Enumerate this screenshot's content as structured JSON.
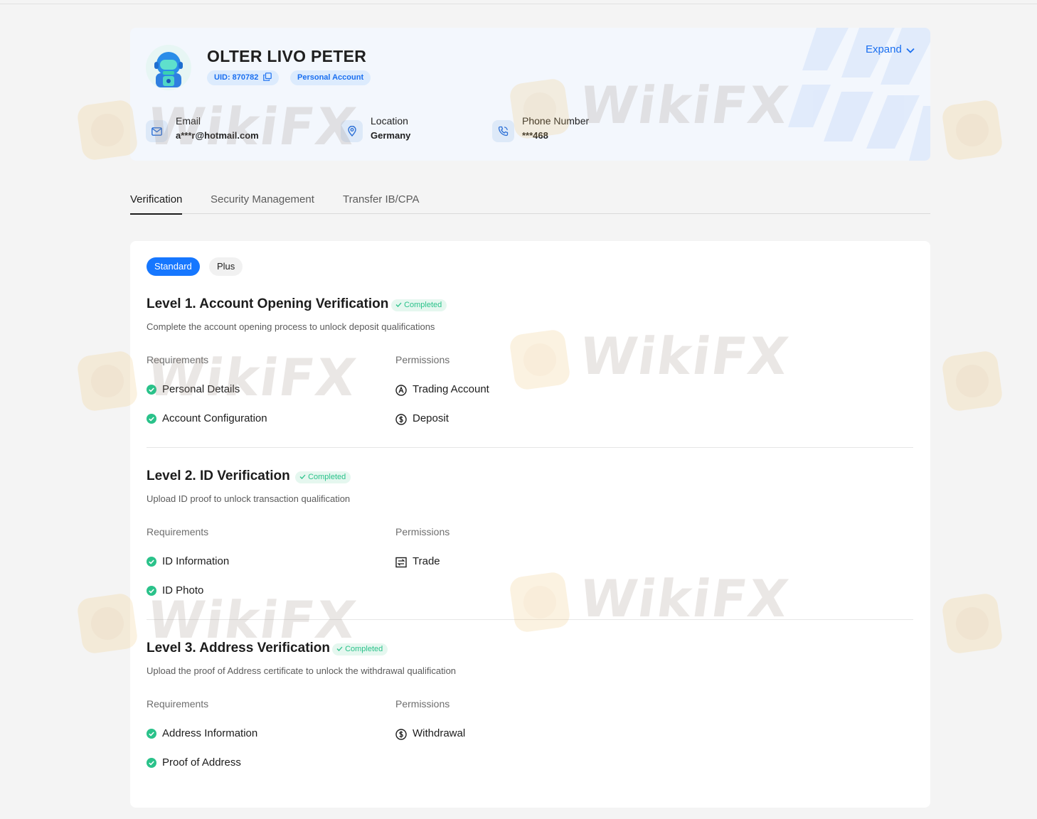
{
  "profile": {
    "name": "OLTER LIVO PETER",
    "uid": "UID: 870782",
    "account_type": "Personal Account",
    "expand": "Expand",
    "email_label": "Email",
    "email_value": "a***r@hotmail.com",
    "location_label": "Location",
    "location_value": "Germany",
    "phone_label": "Phone Number",
    "phone_value": "***468"
  },
  "tabs": [
    "Verification",
    "Security Management",
    "Transfer IB/CPA"
  ],
  "pills": {
    "standard": "Standard",
    "plus": "Plus"
  },
  "levels": [
    {
      "title": "Level 1. Account Opening Verification",
      "status": "Completed",
      "desc": "Complete the account opening process to unlock deposit qualifications",
      "req_label": "Requirements",
      "perm_label": "Permissions",
      "requirements": [
        "Personal Details",
        "Account Configuration"
      ],
      "permissions": [
        {
          "label": "Trading Account",
          "icon": "account-circle-icon"
        },
        {
          "label": "Deposit",
          "icon": "dollar-coin-icon"
        }
      ]
    },
    {
      "title": "Level 2. ID Verification",
      "status": "Completed",
      "desc": "Upload ID proof to unlock transaction qualification",
      "req_label": "Requirements",
      "perm_label": "Permissions",
      "requirements": [
        "ID Information",
        "ID Photo"
      ],
      "permissions": [
        {
          "label": "Trade",
          "icon": "exchange-icon"
        }
      ]
    },
    {
      "title": "Level 3. Address Verification",
      "status": "Completed",
      "desc": "Upload the proof of Address certificate to unlock the withdrawal qualification",
      "req_label": "Requirements",
      "perm_label": "Permissions",
      "requirements": [
        "Address Information",
        "Proof of Address"
      ],
      "permissions": [
        {
          "label": "Withdrawal",
          "icon": "dollar-coin-icon"
        }
      ]
    }
  ],
  "watermark": "WikiFX",
  "colors": {
    "accent": "#1677ff",
    "success": "#2ac28a",
    "background": "#f4f4f4"
  }
}
